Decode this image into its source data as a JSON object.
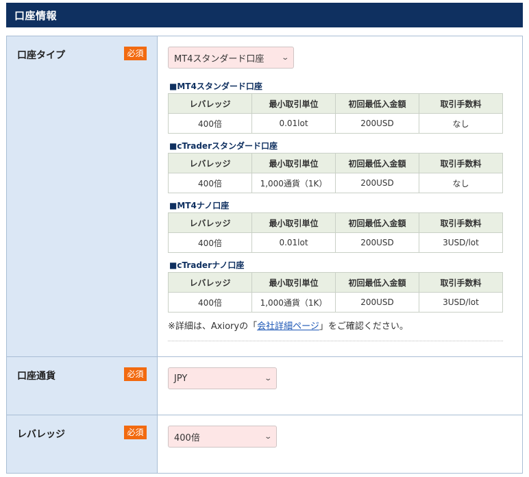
{
  "header": {
    "title": "口座情報"
  },
  "account_type": {
    "label": "口座タイプ",
    "required": "必須",
    "selected": "MT4スタンダード口座",
    "plans": [
      {
        "title": "■MT4スタンダード口座",
        "headers": [
          "レバレッジ",
          "最小取引単位",
          "初回最低入金額",
          "取引手数料"
        ],
        "values": [
          "400倍",
          "0.01lot",
          "200USD",
          "なし"
        ]
      },
      {
        "title": "■cTraderスタンダード口座",
        "headers": [
          "レバレッジ",
          "最小取引単位",
          "初回最低入金額",
          "取引手数料"
        ],
        "values": [
          "400倍",
          "1,000通貨（1K）",
          "200USD",
          "なし"
        ]
      },
      {
        "title": "■MT4ナノ口座",
        "headers": [
          "レバレッジ",
          "最小取引単位",
          "初回最低入金額",
          "取引手数料"
        ],
        "values": [
          "400倍",
          "0.01lot",
          "200USD",
          "3USD/lot"
        ]
      },
      {
        "title": "■cTraderナノ口座",
        "headers": [
          "レバレッジ",
          "最小取引単位",
          "初回最低入金額",
          "取引手数料"
        ],
        "values": [
          "400倍",
          "1,000通貨（1K）",
          "200USD",
          "3USD/lot"
        ]
      }
    ],
    "note_prefix": "※詳細は、Axioryの「",
    "note_link": "会社詳細ページ",
    "note_suffix": "」をご確認ください。"
  },
  "currency": {
    "label": "口座通貨",
    "required": "必須",
    "selected": "JPY"
  },
  "leverage": {
    "label": "レバレッジ",
    "required": "必須",
    "selected": "400倍"
  },
  "icons": {
    "select_arrow": "chevron-down-icon"
  },
  "colors": {
    "header_bg": "#0f3060",
    "required_badge": "#f26a10",
    "label_bg": "#dbe7f5",
    "select_bg": "#fde6e6"
  }
}
